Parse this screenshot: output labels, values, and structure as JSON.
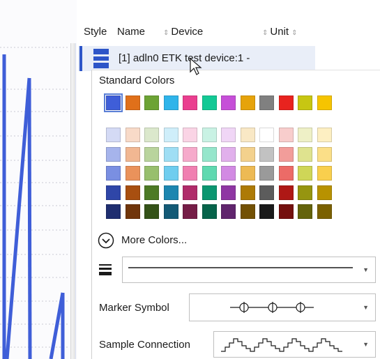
{
  "header": {
    "style_label": "Style",
    "name_label": "Name",
    "device_label": "Device",
    "unit_label": "Unit",
    "sort_glyph": "⇕"
  },
  "signal_row": {
    "text": "[1] adln0  ETK test device:1  -",
    "style_color": "#2d55c8"
  },
  "color_picker": {
    "standard_label": "Standard Colors",
    "standard_colors": [
      "#3f5ed8",
      "#e0701a",
      "#6da335",
      "#2fb4ea",
      "#ea3f8f",
      "#13c995",
      "#c64fd8",
      "#e6a30b",
      "#808080",
      "#e8231f",
      "#c7c612",
      "#f6c400"
    ],
    "theme_rows": [
      [
        "#d4daf5",
        "#f8dac8",
        "#dbe8cc",
        "#cfeefa",
        "#fad4e5",
        "#c9f2e4",
        "#f0d6f6",
        "#f9e8c5",
        "#ffffff",
        "#f8cdcc",
        "#eef0c6",
        "#fdefc2"
      ],
      [
        "#a6b4ec",
        "#f1b792",
        "#b9d49d",
        "#9fdef4",
        "#f6aacb",
        "#95e6cb",
        "#e1b0ec",
        "#f3d18d",
        "#c2c2c2",
        "#f29d9a",
        "#dfe38f",
        "#fbdf88"
      ],
      [
        "#7a8fe2",
        "#ea925b",
        "#98bf6d",
        "#6fcdef",
        "#f07fb1",
        "#5fd9b0",
        "#d28ae3",
        "#edba54",
        "#9a9a9a",
        "#ec6b67",
        "#cfd657",
        "#f9cf4d"
      ],
      [
        "#2f46a8",
        "#a84f10",
        "#4d7a25",
        "#1d86b0",
        "#b02c6a",
        "#0b9670",
        "#8f37a3",
        "#ad7a06",
        "#5c5c5c",
        "#ae1815",
        "#969510",
        "#b89200"
      ],
      [
        "#1f2e70",
        "#70350b",
        "#345218",
        "#135a76",
        "#761d47",
        "#07644b",
        "#60256d",
        "#735104",
        "#1a1a1a",
        "#74100e",
        "#64630b",
        "#7b6100"
      ]
    ],
    "more_colors_label": "More Colors..."
  },
  "line_style": {
    "value": ""
  },
  "marker_symbol": {
    "label": "Marker Symbol",
    "value": ""
  },
  "sample_connection": {
    "label": "Sample Connection",
    "value": ""
  }
}
